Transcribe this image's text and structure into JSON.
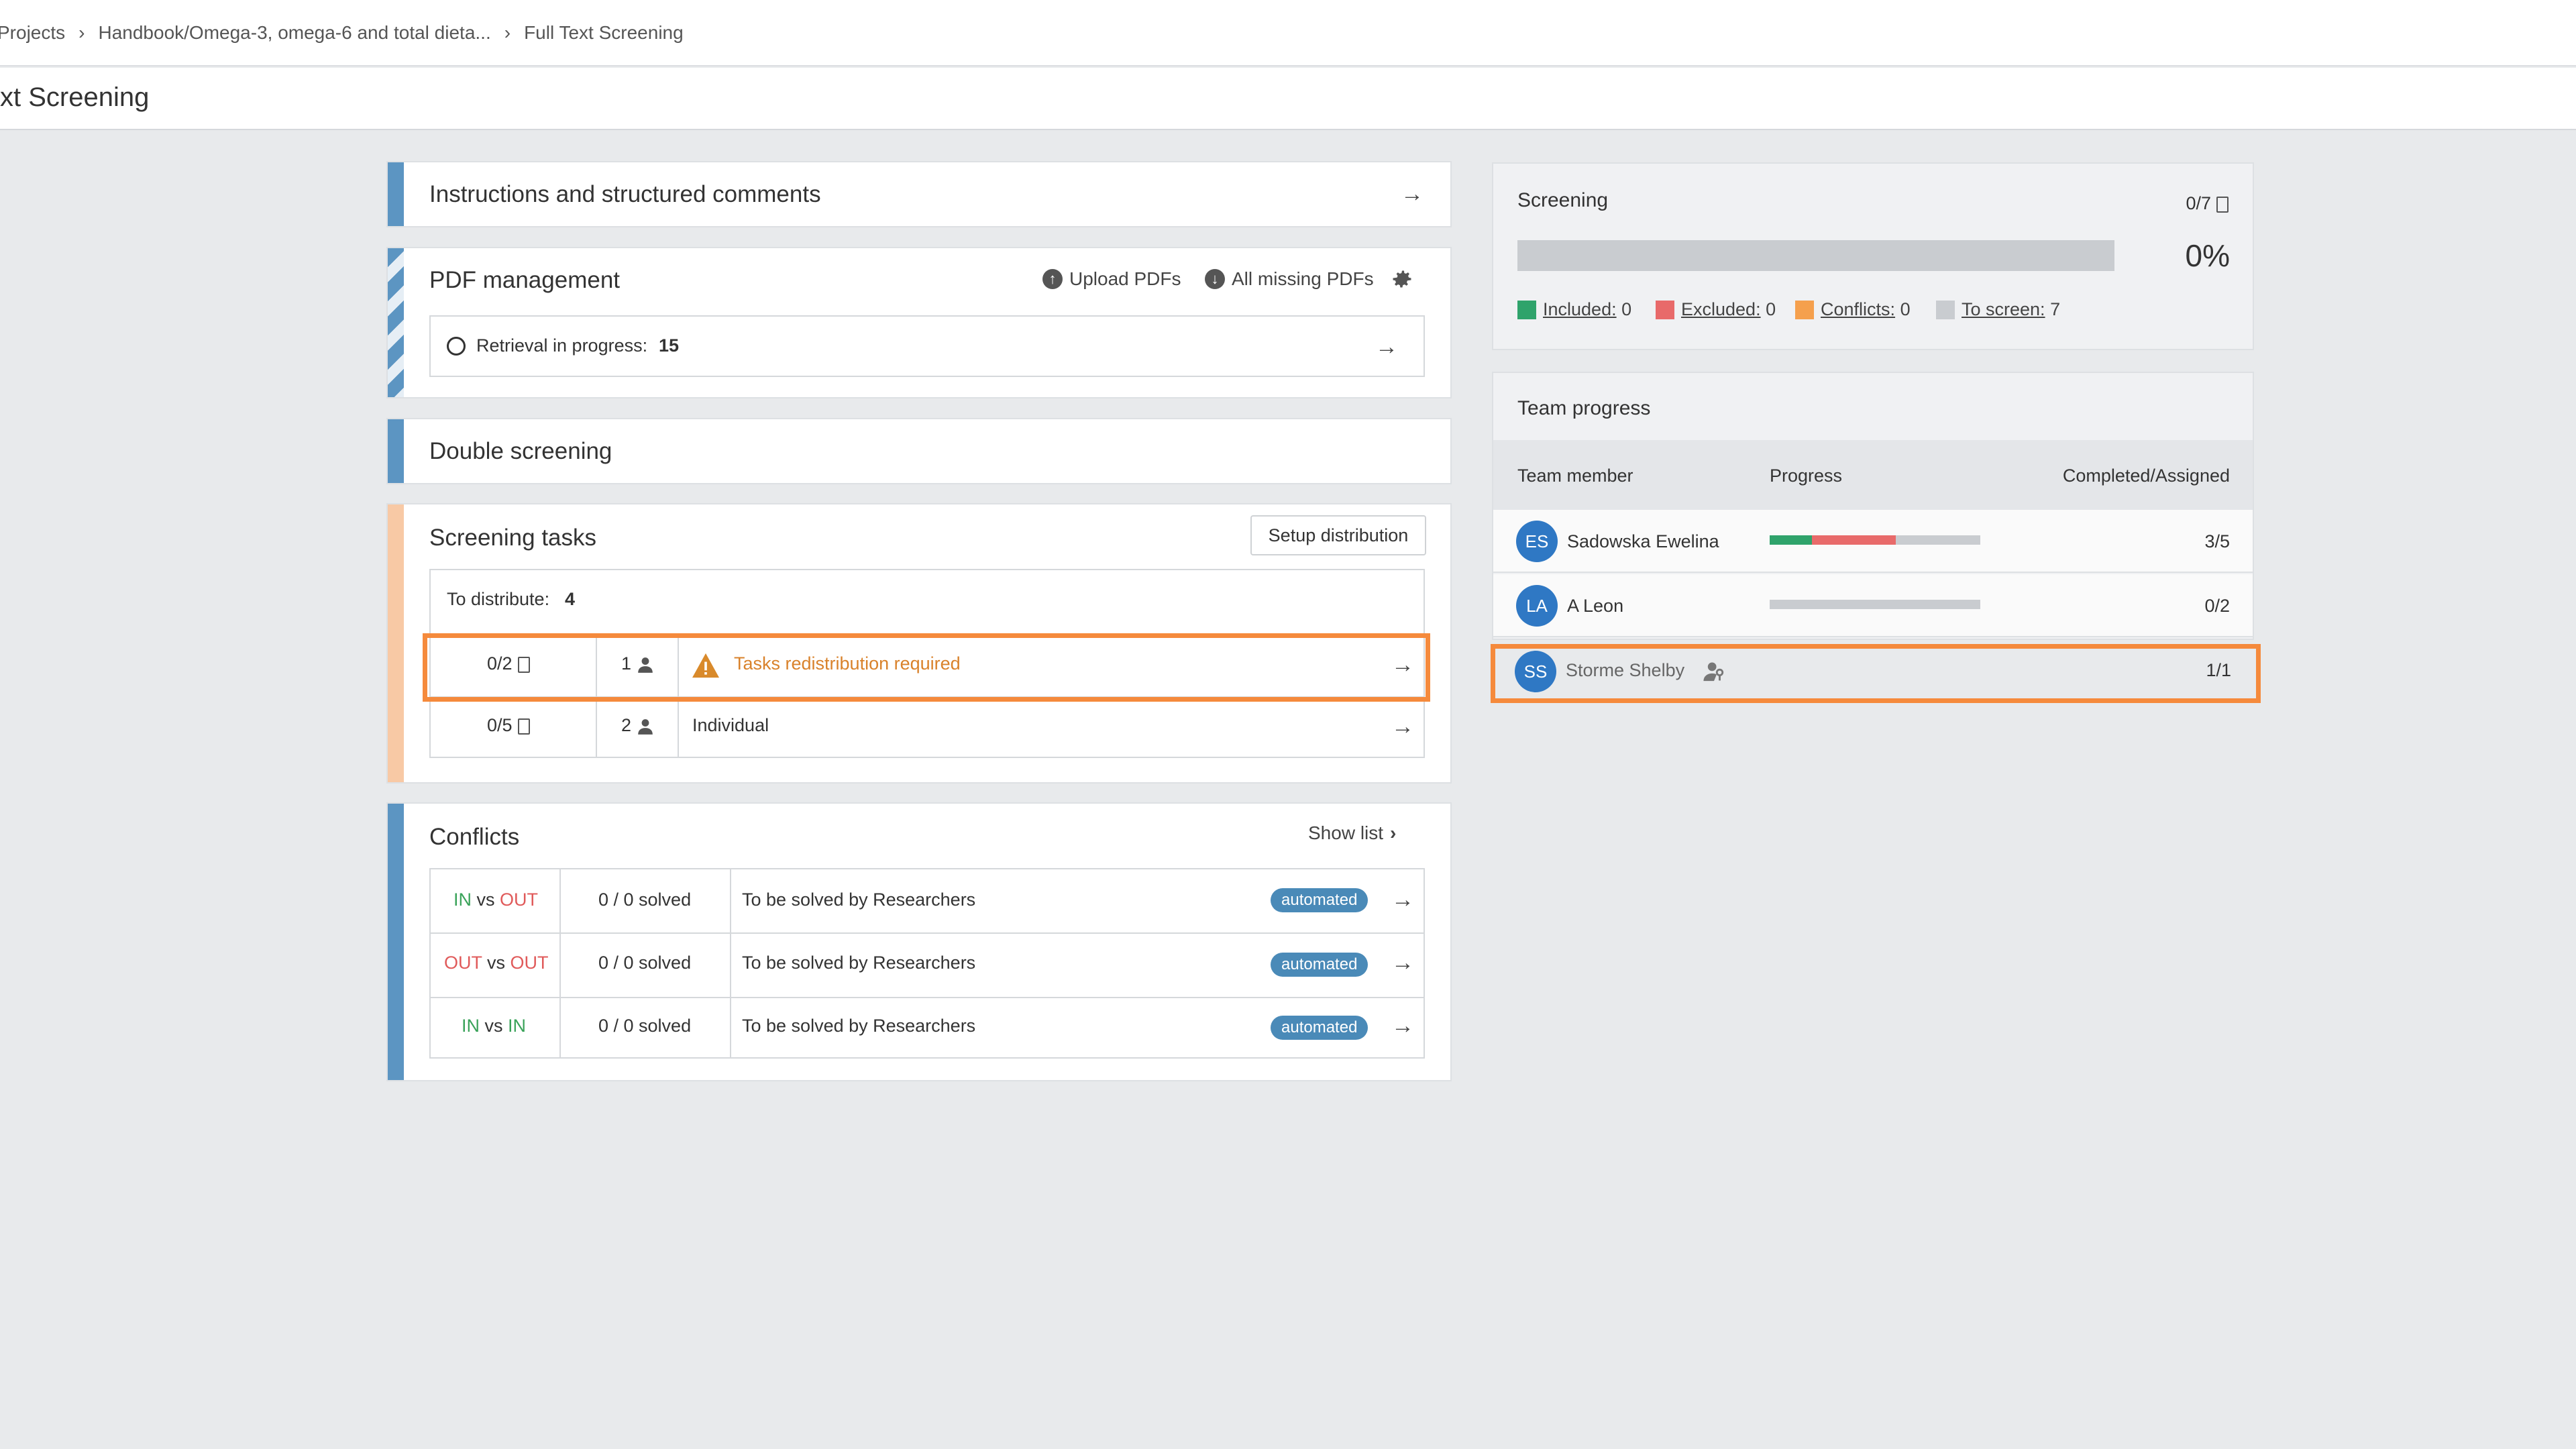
{
  "breadcrumb": {
    "items": [
      "Projects",
      "Handbook/Omega-3, omega-6 and total dieta...",
      "Full Text Screening"
    ],
    "separator": "›"
  },
  "page": {
    "title": "xt Screening"
  },
  "instructions": {
    "title": "Instructions and structured comments"
  },
  "pdf": {
    "title": "PDF management",
    "upload_label": "Upload PDFs",
    "missing_label": "All missing PDFs",
    "retrieval_label": "Retrieval in progress:",
    "retrieval_count": "15"
  },
  "double_screening": {
    "title": "Double screening"
  },
  "tasks": {
    "title": "Screening tasks",
    "setup_label": "Setup distribution",
    "to_distribute_label": "To distribute:",
    "to_distribute_count": "4",
    "rows": [
      {
        "docs": "0/2",
        "members": "1",
        "status": "Tasks redistribution required"
      },
      {
        "docs": "0/5",
        "members": "2",
        "status": "Individual"
      }
    ]
  },
  "conflicts": {
    "title": "Conflicts",
    "show_list_label": "Show list",
    "rows": [
      {
        "a": "IN",
        "vs": "vs",
        "b": "OUT",
        "solved": "0 / 0 solved",
        "desc": "To be solved by Researchers",
        "badge": "automated"
      },
      {
        "a": "OUT",
        "vs": "vs",
        "b": "OUT",
        "solved": "0 / 0 solved",
        "desc": "To be solved by Researchers",
        "badge": "automated"
      },
      {
        "a": "IN",
        "vs": "vs",
        "b": "IN",
        "solved": "0 / 0 solved",
        "desc": "To be solved by Researchers",
        "badge": "automated"
      }
    ]
  },
  "screening": {
    "title": "Screening",
    "count": "0/7",
    "percent": "0%",
    "progress_fraction": 0,
    "legend": [
      {
        "label": "Included:",
        "value": "0",
        "color": "#2fa36b"
      },
      {
        "label": "Excluded:",
        "value": "0",
        "color": "#e86a6a"
      },
      {
        "label": "Conflicts:",
        "value": "0",
        "color": "#f5a04d"
      },
      {
        "label": "To screen:",
        "value": "7",
        "color": "#c9ccd0"
      }
    ]
  },
  "team": {
    "title": "Team progress",
    "col_member": "Team member",
    "col_progress": "Progress",
    "col_completed": "Completed/Assigned",
    "members": [
      {
        "initials": "ES",
        "name": "Sadowska Ewelina",
        "completed": "3/5",
        "green": 0.2,
        "red": 0.4
      },
      {
        "initials": "LA",
        "name": "A Leon",
        "completed": "0/2",
        "green": 0,
        "red": 0
      },
      {
        "initials": "SS",
        "name": "Storme Shelby",
        "completed": "1/1",
        "green": 0,
        "red": 0
      }
    ]
  }
}
